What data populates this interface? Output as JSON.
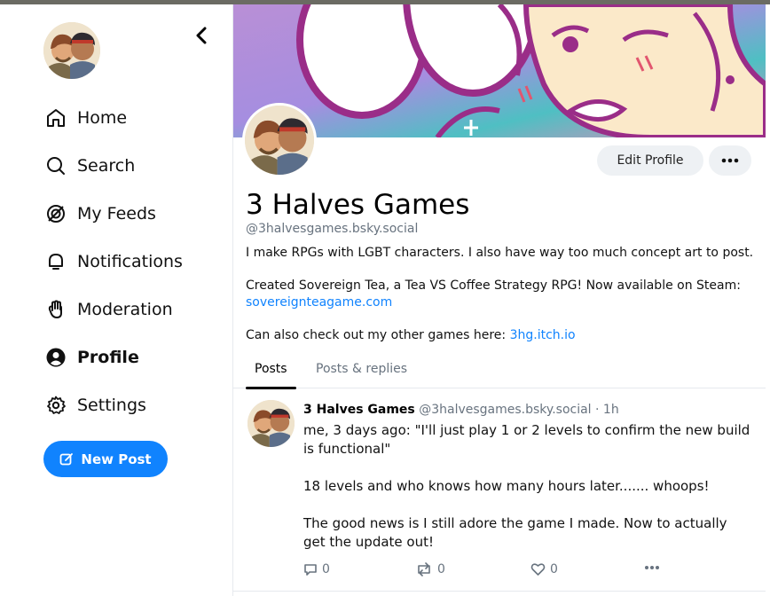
{
  "sidebar": {
    "nav": [
      {
        "label": "Home",
        "icon": "home-icon"
      },
      {
        "label": "Search",
        "icon": "search-icon"
      },
      {
        "label": "My Feeds",
        "icon": "feeds-icon"
      },
      {
        "label": "Notifications",
        "icon": "bell-icon"
      },
      {
        "label": "Moderation",
        "icon": "hand-icon"
      },
      {
        "label": "Profile",
        "icon": "user-circle-icon",
        "active": true
      },
      {
        "label": "Settings",
        "icon": "gear-icon"
      }
    ],
    "new_post_label": "New Post",
    "accent": "#1083fe"
  },
  "profile": {
    "edit_label": "Edit Profile",
    "display_name": "3 Halves Games",
    "handle": "@3halvesgames.bsky.social",
    "bio_line1": "I make RPGs with LGBT characters. I also have way too much concept art to post.",
    "bio_line2": "Created Sovereign Tea, a Tea VS Coffee Strategy RPG! Now available on Steam:",
    "bio_link1": "sovereignteagame.com",
    "bio_line3": "Can also check out my other games here:",
    "bio_link2": "3hg.itch.io"
  },
  "tabs": [
    {
      "label": "Posts",
      "active": true
    },
    {
      "label": "Posts & replies"
    }
  ],
  "post": {
    "author": "3 Halves Games",
    "handle": "@3halvesgames.bsky.social",
    "time": "· 1h",
    "paragraphs": [
      "me, 3 days ago: \"I'll just play 1 or 2 levels to confirm the new build is functional\"",
      "18 levels and who knows how many hours later....... whoops!",
      "The good news is I still adore the game I made. Now to actually get the update out!"
    ],
    "reply_count": "0",
    "repost_count": "0",
    "like_count": "0"
  }
}
